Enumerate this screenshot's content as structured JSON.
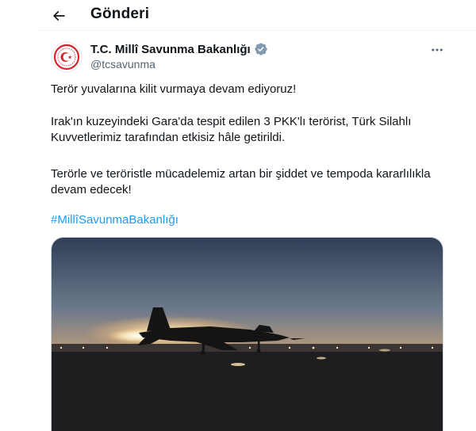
{
  "header": {
    "title": "Gönderi"
  },
  "account": {
    "display_name": "T.C. Millî Savunma Bakanlığı",
    "handle": "@tcsavunma",
    "verified": true
  },
  "tweet": {
    "paragraph_1": "Terör yuvalarına kilit vurmaya devam ediyoruz!",
    "paragraph_2": "Irak'ın kuzeyindeki Gara'da tespit edilen 3 PKK'lı terörist, Türk Silahlı Kuvvetlerimiz tarafından etkisiz hâle getirildi.",
    "paragraph_3": "Terörle ve teröristle mücadelemiz artan bir şiddet ve tempoda kararlılıkla devam edecek!",
    "hashtag": "#MillîSavunmaBakanlığı"
  },
  "colors": {
    "text": "#0f1419",
    "secondary": "#536471",
    "link": "#1d9bf0",
    "verified_badge": "#829aab",
    "emblem_red": "#d8232a"
  },
  "icons": {
    "back": "arrow-left-icon",
    "verified": "verified-badge-icon",
    "more": "more-horizontal-icon"
  }
}
